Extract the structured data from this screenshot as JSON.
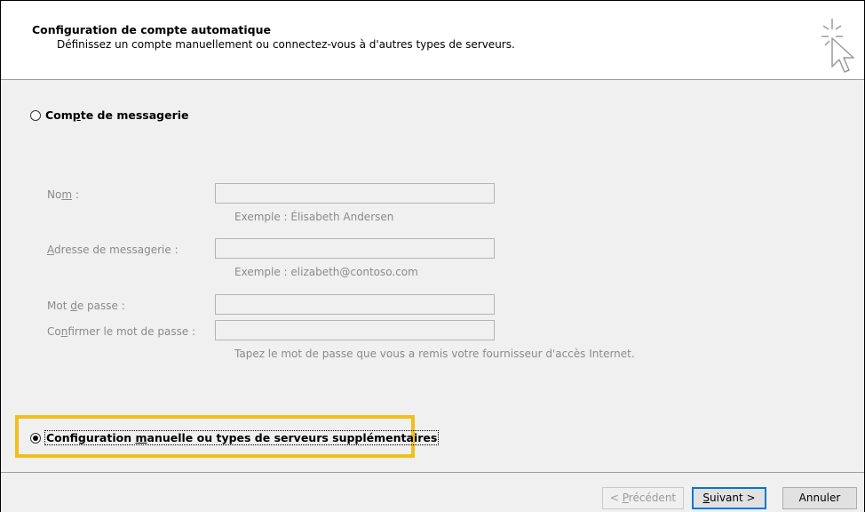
{
  "header": {
    "title": "Configuration de compte automatique",
    "subtitle": "Définissez un compte manuellement ou connectez-vous à d'autres types de serveurs."
  },
  "options": {
    "email_account": {
      "label_pre": "Com",
      "label_access": "p",
      "label_post": "te de messagerie",
      "selected": false
    },
    "manual_config": {
      "label_pre": "Configuration ",
      "label_access": "m",
      "label_post": "anuelle ou types de serveurs supplémentaires",
      "selected": true
    }
  },
  "form": {
    "name": {
      "label_pre": "No",
      "label_access": "m",
      "label_post": " :",
      "value": "",
      "hint": "Exemple : Élisabeth Andersen"
    },
    "email": {
      "label_pre": "",
      "label_access": "A",
      "label_post": "dresse de messagerie :",
      "value": "",
      "hint": "Exemple : elizabeth@contoso.com"
    },
    "password": {
      "label_pre": "Mot ",
      "label_access": "d",
      "label_post": "e passe :",
      "value": ""
    },
    "confirm": {
      "label_pre": "Co",
      "label_access": "n",
      "label_post": "firmer le mot de passe :",
      "value": ""
    },
    "password_hint": "Tapez le mot de passe que vous a remis votre fournisseur d'accès Internet."
  },
  "buttons": {
    "back": {
      "prefix": "< ",
      "access": "P",
      "rest": "récédent"
    },
    "next": {
      "access": "S",
      "rest": "uivant >"
    },
    "cancel": "Annuler"
  },
  "colors": {
    "highlight": "#f2bf18",
    "default_button": "#0078d7"
  },
  "icons": {
    "wizard": "cursor-sparkle-icon"
  }
}
